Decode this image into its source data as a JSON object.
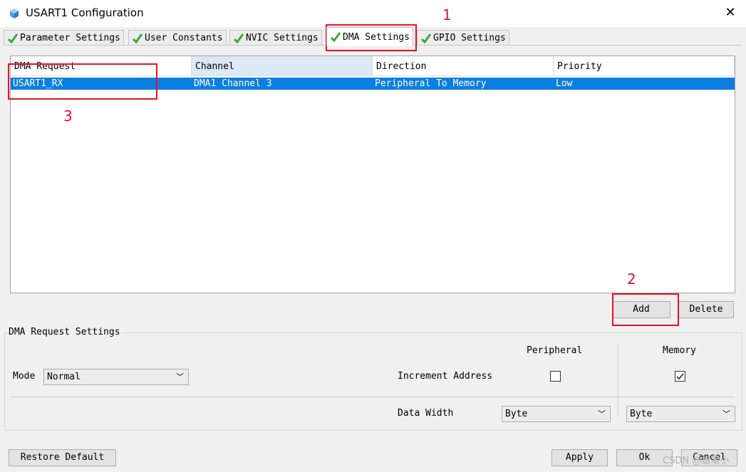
{
  "window": {
    "title": "USART1 Configuration",
    "close_glyph": "✕",
    "icon": "cube-icon"
  },
  "tabs": [
    {
      "label": "Parameter Settings",
      "icon": "check-icon"
    },
    {
      "label": "User Constants",
      "icon": "check-icon"
    },
    {
      "label": "NVIC Settings",
      "icon": "check-icon"
    },
    {
      "label": "DMA Settings",
      "icon": "check-icon",
      "active": true
    },
    {
      "label": "GPIO Settings",
      "icon": "check-icon"
    }
  ],
  "table": {
    "headers": [
      "DMA Request",
      "Channel",
      "Direction",
      "Priority"
    ],
    "rows": [
      {
        "request": "USART1_RX",
        "channel": "DMA1 Channel 3",
        "direction": "Peripheral To Memory",
        "priority": "Low",
        "selected": true
      }
    ]
  },
  "buttons": {
    "add": "Add",
    "delete": "Delete",
    "restore": "Restore Default",
    "apply": "Apply",
    "ok": "Ok",
    "cancel": "Cancel"
  },
  "request_settings": {
    "title": "DMA Request Settings",
    "mode_label": "Mode",
    "mode_value": "Normal",
    "peripheral_label": "Peripheral",
    "memory_label": "Memory",
    "increment_label": "Increment Address",
    "peripheral_increment": false,
    "memory_increment": true,
    "data_width_label": "Data Width",
    "peripheral_width": "Byte",
    "memory_width": "Byte"
  },
  "annotations": [
    "1",
    "2",
    "3"
  ],
  "watermark": "CSDN @蜡笔小",
  "colors": {
    "accent_red": "#e81123",
    "selection_blue": "#0b7ee3",
    "check_green": "#3aa53a"
  }
}
